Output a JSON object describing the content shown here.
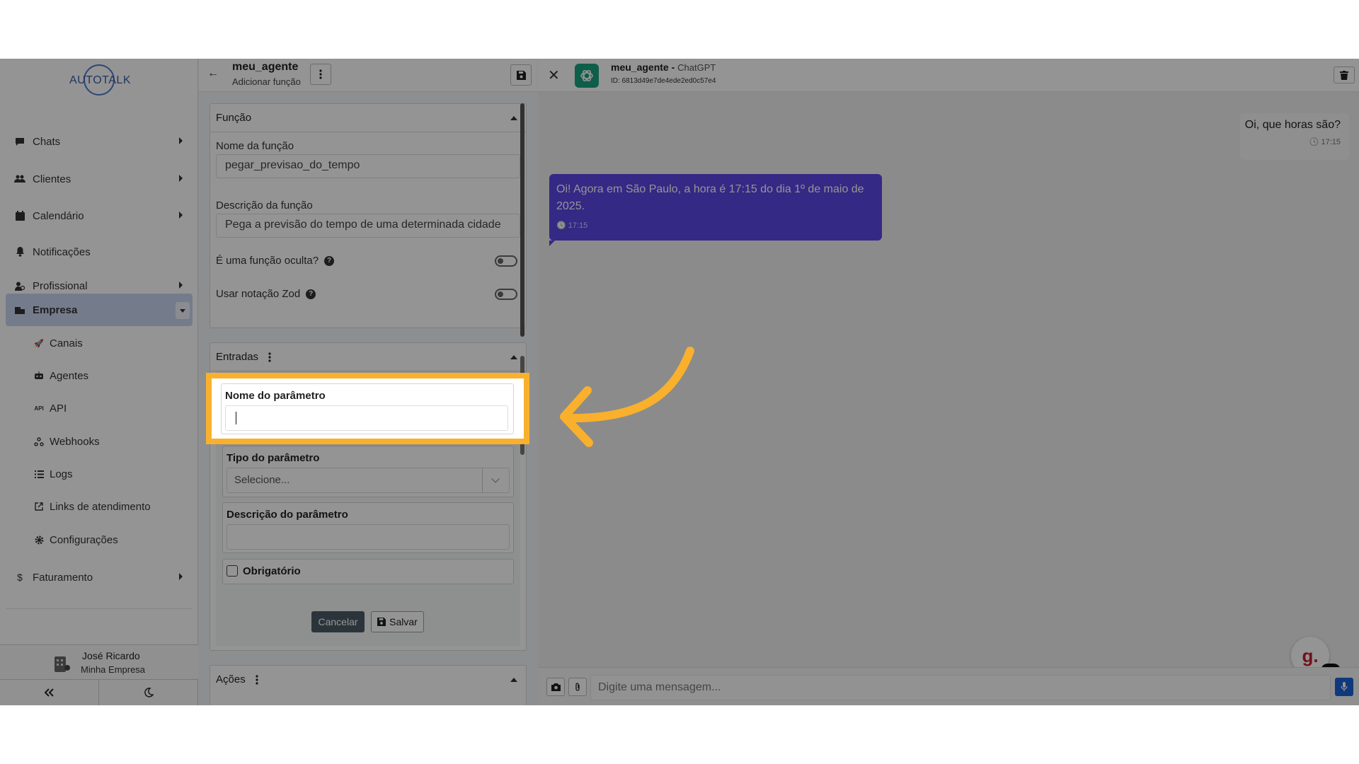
{
  "sidebar": {
    "logo_text": "AUTOTALK",
    "nav": [
      {
        "label": "Chats",
        "icon": "comment-icon"
      },
      {
        "label": "Clientes",
        "icon": "users-icon"
      },
      {
        "label": "Calendário",
        "icon": "calendar-icon"
      },
      {
        "label": "Notificações",
        "icon": "bell-icon"
      },
      {
        "label": "Profissional",
        "icon": "user-tie-icon"
      },
      {
        "label": "Empresa",
        "icon": "building-icon"
      }
    ],
    "sub": [
      {
        "label": "Canais",
        "icon": "rocket-icon"
      },
      {
        "label": "Agentes",
        "icon": "robot-icon"
      },
      {
        "label": "API",
        "icon": "api-icon"
      },
      {
        "label": "Webhooks",
        "icon": "webhook-icon"
      },
      {
        "label": "Logs",
        "icon": "list-icon"
      },
      {
        "label": "Links de atendimento",
        "icon": "external-link-icon"
      },
      {
        "label": "Configurações",
        "icon": "gear-icon"
      }
    ],
    "billing": {
      "label": "Faturamento",
      "icon": "dollar-icon"
    },
    "user": {
      "name": "José Ricardo",
      "company": "Minha Empresa"
    }
  },
  "middle": {
    "title": "meu_agente",
    "subtitle": "Adicionar função",
    "funcao": {
      "header": "Função",
      "name_label": "Nome da função",
      "name_value": "pegar_previsao_do_tempo",
      "desc_label": "Descrição da função",
      "desc_value": "Pega a previsão do tempo de uma determinada cidade",
      "hidden_label": "É uma função oculta?",
      "zod_label": "Usar notação Zod"
    },
    "entradas": {
      "header": "Entradas",
      "param_name_label": "Nome do parâmetro",
      "param_type_label": "Tipo do parâmetro",
      "param_type_placeholder": "Selecione...",
      "param_desc_label": "Descrição do parâmetro",
      "required_label": "Obrigatório",
      "cancel": "Cancelar",
      "save": "Salvar"
    },
    "acoes": {
      "header": "Ações"
    }
  },
  "chat": {
    "agent": "meu_agente",
    "model": "ChatGPT",
    "id": "ID: 6813d49e7de4ede2ed0c57e4",
    "outgoing": {
      "text": "Oi, que horas são?",
      "time": "17:15"
    },
    "incoming": {
      "text": "Oi! Agora em São Paulo, a hora é 17:15 do dia 1º de maio de 2025.",
      "time": "17:15"
    },
    "input_placeholder": "Digite uma mensagem...",
    "widget_letter": "g.",
    "widget_badge": "26"
  },
  "colors": {
    "highlight": "#f9b02d",
    "incoming_bubble": "#5a47e6",
    "active_nav": "#c9d6f2",
    "mic_button": "#1a63d6"
  }
}
